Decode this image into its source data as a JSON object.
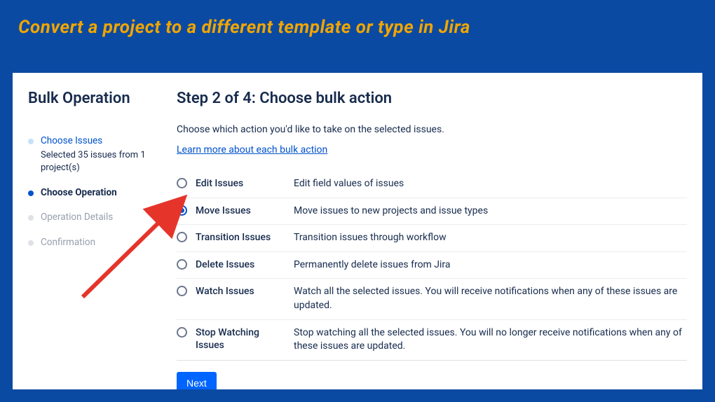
{
  "banner": "Convert a project to a different template or type in Jira",
  "sidebar": {
    "title": "Bulk Operation",
    "steps": [
      {
        "label": "Choose Issues",
        "sub": "Selected 35 issues from 1 project(s)",
        "state": "past"
      },
      {
        "label": "Choose Operation",
        "state": "active"
      },
      {
        "label": "Operation Details",
        "state": "future"
      },
      {
        "label": "Confirmation",
        "state": "future"
      }
    ]
  },
  "main": {
    "title": "Step 2 of 4: Choose bulk action",
    "desc": "Choose which action you'd like to take on the selected issues.",
    "learn_link": "Learn more about each bulk action",
    "options": [
      {
        "label": "Edit Issues",
        "desc": "Edit field values of issues",
        "selected": false
      },
      {
        "label": "Move Issues",
        "desc": "Move issues to new projects and issue types",
        "selected": true
      },
      {
        "label": "Transition Issues",
        "desc": "Transition issues through workflow",
        "selected": false
      },
      {
        "label": "Delete Issues",
        "desc": "Permanently delete issues from Jira",
        "selected": false
      },
      {
        "label": "Watch Issues",
        "desc": "Watch all the selected issues. You will receive notifications when any of these issues are updated.",
        "selected": false
      },
      {
        "label": "Stop Watching Issues",
        "desc": "Stop watching all the selected issues. You will no longer receive notifications when any of these issues are updated.",
        "selected": false
      }
    ],
    "next": "Next"
  }
}
